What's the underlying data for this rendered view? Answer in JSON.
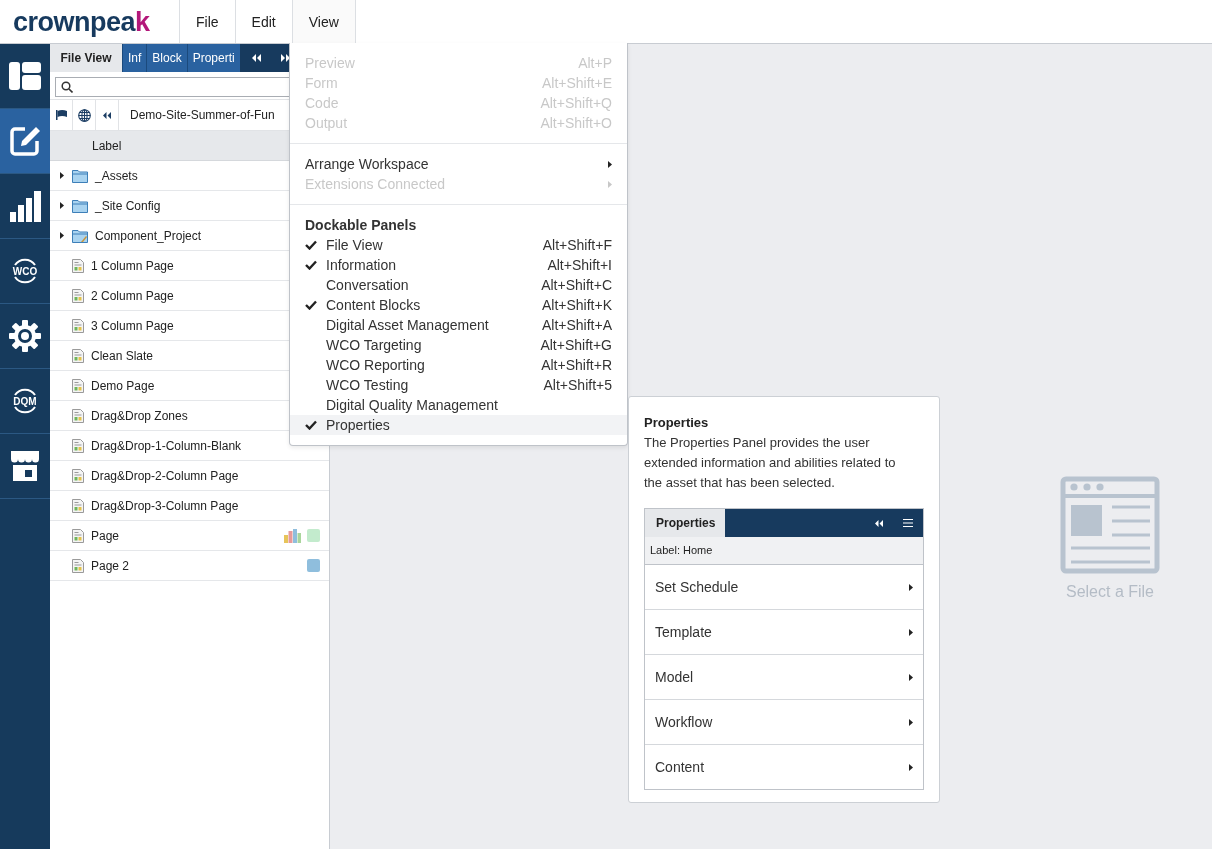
{
  "header": {
    "logo": "crownpeak",
    "menus": [
      {
        "label": "File",
        "selected": false
      },
      {
        "label": "Edit",
        "selected": false
      },
      {
        "label": "View",
        "selected": true
      }
    ]
  },
  "rail": [
    {
      "kind": "layout",
      "selected": false
    },
    {
      "kind": "edit",
      "selected": true
    },
    {
      "kind": "chart",
      "selected": false
    },
    {
      "kind": "badge",
      "label": "WCO",
      "selected": false
    },
    {
      "kind": "gear",
      "selected": false
    },
    {
      "kind": "badge",
      "label": "DQM",
      "selected": false
    },
    {
      "kind": "store",
      "selected": false
    }
  ],
  "file_panel": {
    "tabs": [
      {
        "label": "File View",
        "selected": true
      },
      {
        "label": "Inf",
        "selected": false
      },
      {
        "label": "Block",
        "selected": false
      },
      {
        "label": "Properti",
        "selected": false
      }
    ],
    "path": "Demo-Site-Summer-of-Fun",
    "column": "Label",
    "rows": [
      {
        "kind": "folder",
        "label": "_Assets",
        "expandable": true
      },
      {
        "kind": "folder",
        "label": "_Site Config",
        "expandable": true
      },
      {
        "kind": "project",
        "label": "Component_Project",
        "expandable": true
      },
      {
        "kind": "page",
        "label": "1 Column Page"
      },
      {
        "kind": "page",
        "label": "2 Column Page"
      },
      {
        "kind": "page",
        "label": "3 Column Page"
      },
      {
        "kind": "page",
        "label": "Clean Slate"
      },
      {
        "kind": "page",
        "label": "Demo Page"
      },
      {
        "kind": "page",
        "label": "Drag&Drop Zones"
      },
      {
        "kind": "page",
        "label": "Drag&Drop-1-Column-Blank"
      },
      {
        "kind": "page",
        "label": "Drag&Drop-2-Column Page"
      },
      {
        "kind": "page",
        "label": "Drag&Drop-3-Column Page"
      },
      {
        "kind": "page",
        "label": "Page",
        "report": true,
        "color": "#c3ebcd"
      },
      {
        "kind": "page",
        "label": "Page 2",
        "color": "#8fbedd"
      }
    ]
  },
  "view_menu": {
    "groups": [
      {
        "items": [
          {
            "label": "Preview",
            "shortcut": "Alt+P",
            "disabled": true
          },
          {
            "label": "Form",
            "shortcut": "Alt+Shift+E",
            "disabled": true
          },
          {
            "label": "Code",
            "shortcut": "Alt+Shift+Q",
            "disabled": true
          },
          {
            "label": "Output",
            "shortcut": "Alt+Shift+O",
            "disabled": true
          }
        ]
      },
      {
        "items": [
          {
            "label": "Arrange Workspace",
            "disabled": false,
            "submenu": true
          },
          {
            "label": "Extensions Connected",
            "disabled": true,
            "submenu": true
          }
        ]
      },
      {
        "heading": "Dockable Panels",
        "items": [
          {
            "label": "File View",
            "shortcut": "Alt+Shift+F",
            "checked": true,
            "highlighted": false
          },
          {
            "label": "Information",
            "shortcut": "Alt+Shift+I",
            "checked": true,
            "highlighted": false
          },
          {
            "label": "Conversation",
            "shortcut": "Alt+Shift+C",
            "checked": false,
            "highlighted": false
          },
          {
            "label": "Content Blocks",
            "shortcut": "Alt+Shift+K",
            "checked": true,
            "highlighted": false
          },
          {
            "label": "Digital Asset Management",
            "shortcut": "Alt+Shift+A",
            "checked": false,
            "highlighted": false
          },
          {
            "label": "WCO Targeting",
            "shortcut": "Alt+Shift+G",
            "checked": false,
            "highlighted": false
          },
          {
            "label": "WCO Reporting",
            "shortcut": "Alt+Shift+R",
            "checked": false,
            "highlighted": false
          },
          {
            "label": "WCO Testing",
            "shortcut": "Alt+Shift+5",
            "checked": false,
            "highlighted": false
          },
          {
            "label": "Digital Quality Management",
            "checked": false,
            "highlighted": false
          },
          {
            "label": "Properties",
            "checked": true,
            "highlighted": true
          }
        ]
      }
    ]
  },
  "tooltip": {
    "title": "Properties",
    "text": "The Properties Panel provides the user extended information and abilities related to the asset that has been selected.",
    "preview": {
      "tab": "Properties",
      "label": "Label: Home",
      "rows": [
        "Set Schedule",
        "Template",
        "Model",
        "Workflow",
        "Content"
      ]
    }
  },
  "empty_state": {
    "text": "Select a File"
  }
}
